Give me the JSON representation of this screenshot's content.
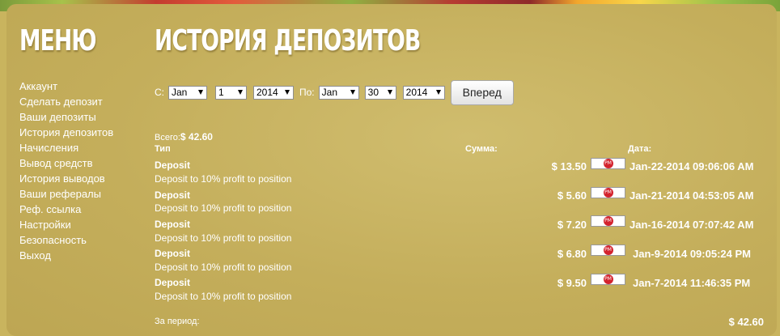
{
  "menu": {
    "title": "МЕНЮ",
    "items": [
      {
        "label": "Аккаунт"
      },
      {
        "label": "Сделать депозит"
      },
      {
        "label": "Ваши депозиты"
      },
      {
        "label": "История депозитов"
      },
      {
        "label": "Начисления"
      },
      {
        "label": "Вывод средств"
      },
      {
        "label": "История выводов"
      },
      {
        "label": "Ваши рефералы"
      },
      {
        "label": "Реф. ссылка"
      },
      {
        "label": "Настройки"
      },
      {
        "label": "Безопасность"
      },
      {
        "label": "Выход"
      }
    ]
  },
  "page": {
    "title": "ИСТОРИЯ ДЕПОЗИТОВ"
  },
  "filter": {
    "from_label": "С:",
    "to_label": "По:",
    "from_month": "Jan",
    "from_day": "1",
    "from_year": "2014",
    "to_month": "Jan",
    "to_day": "30",
    "to_year": "2014",
    "submit_label": "Вперед"
  },
  "summary": {
    "total_label": "Всего:",
    "total_value": "$ 42.60",
    "period_label": "За период:",
    "period_value": "$ 42.60"
  },
  "table": {
    "headers": {
      "type": "Тип",
      "amount": "Сумма:",
      "date": "Дата:"
    },
    "payment_icon": "perfect-money-icon",
    "payment_badge_text": "PM",
    "rows": [
      {
        "type": "Deposit",
        "desc": "Deposit to 10% profit to position",
        "amount": "$ 13.50",
        "date": "Jan-22-2014 09:06:06 AM"
      },
      {
        "type": "Deposit",
        "desc": "Deposit to 10% profit to position",
        "amount": "$ 5.60",
        "date": "Jan-21-2014 04:53:05 AM"
      },
      {
        "type": "Deposit",
        "desc": "Deposit to 10% profit to position",
        "amount": "$ 7.20",
        "date": "Jan-16-2014 07:07:42 AM"
      },
      {
        "type": "Deposit",
        "desc": "Deposit to 10% profit to position",
        "amount": "$ 6.80",
        "date": "Jan-9-2014 09:05:24 PM"
      },
      {
        "type": "Deposit",
        "desc": "Deposit to 10% profit to position",
        "amount": "$ 9.50",
        "date": "Jan-7-2014 11:46:35 PM"
      }
    ]
  },
  "colors": {
    "background": "#c9b45e",
    "text": "#ffffff",
    "pm_badge": "#d3232e"
  }
}
